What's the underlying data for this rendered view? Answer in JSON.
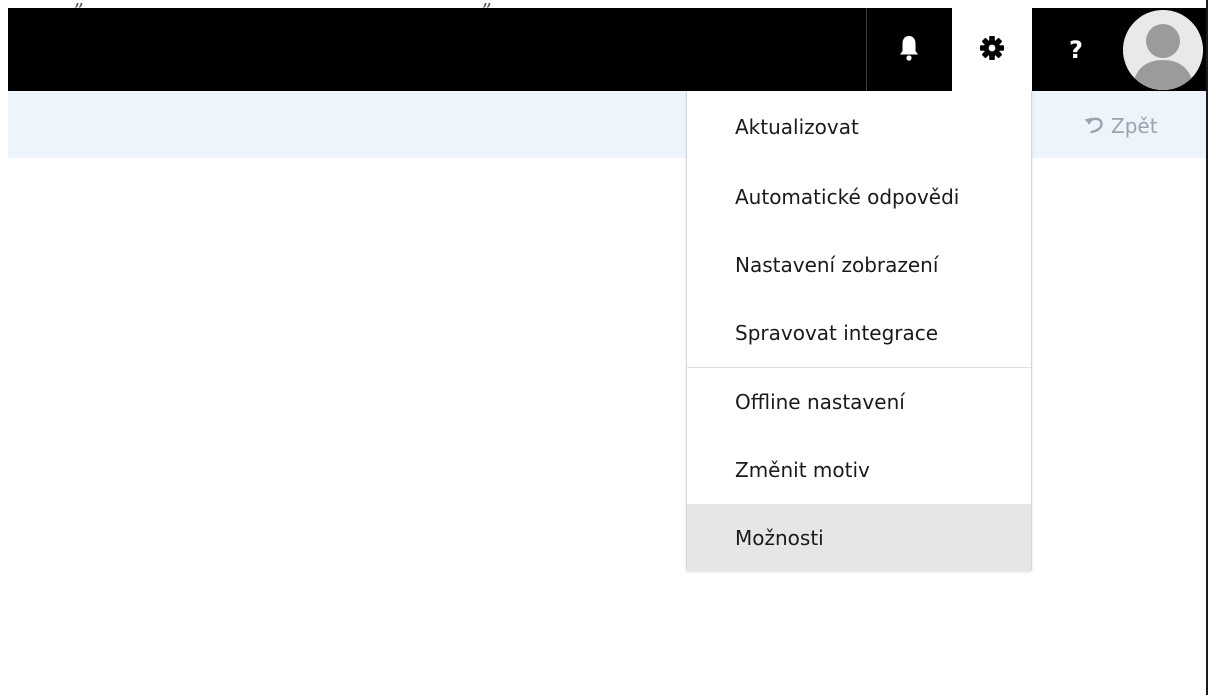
{
  "header": {
    "icons": [
      "bell-icon",
      "gear-icon",
      "help-icon",
      "avatar-icon"
    ],
    "help_label": "?",
    "top_marks": [
      "„",
      "„"
    ],
    "colors": {
      "topbar": "#000000",
      "subbar": "#eef4fb",
      "icon": "#ffffff"
    }
  },
  "toolbar": {
    "undo_label": "Zpět",
    "undo_icon": "undo-icon"
  },
  "settings_menu": {
    "items": [
      {
        "label": "Aktualizovat"
      },
      {
        "label": "Automatické odpovědi"
      },
      {
        "label": "Nastavení zobrazení"
      },
      {
        "label": "Spravovat integrace"
      },
      {
        "label": "Offline nastavení"
      },
      {
        "label": "Změnit motiv"
      },
      {
        "label": "Možnosti"
      }
    ],
    "hover_color": "#e6e6e6"
  }
}
